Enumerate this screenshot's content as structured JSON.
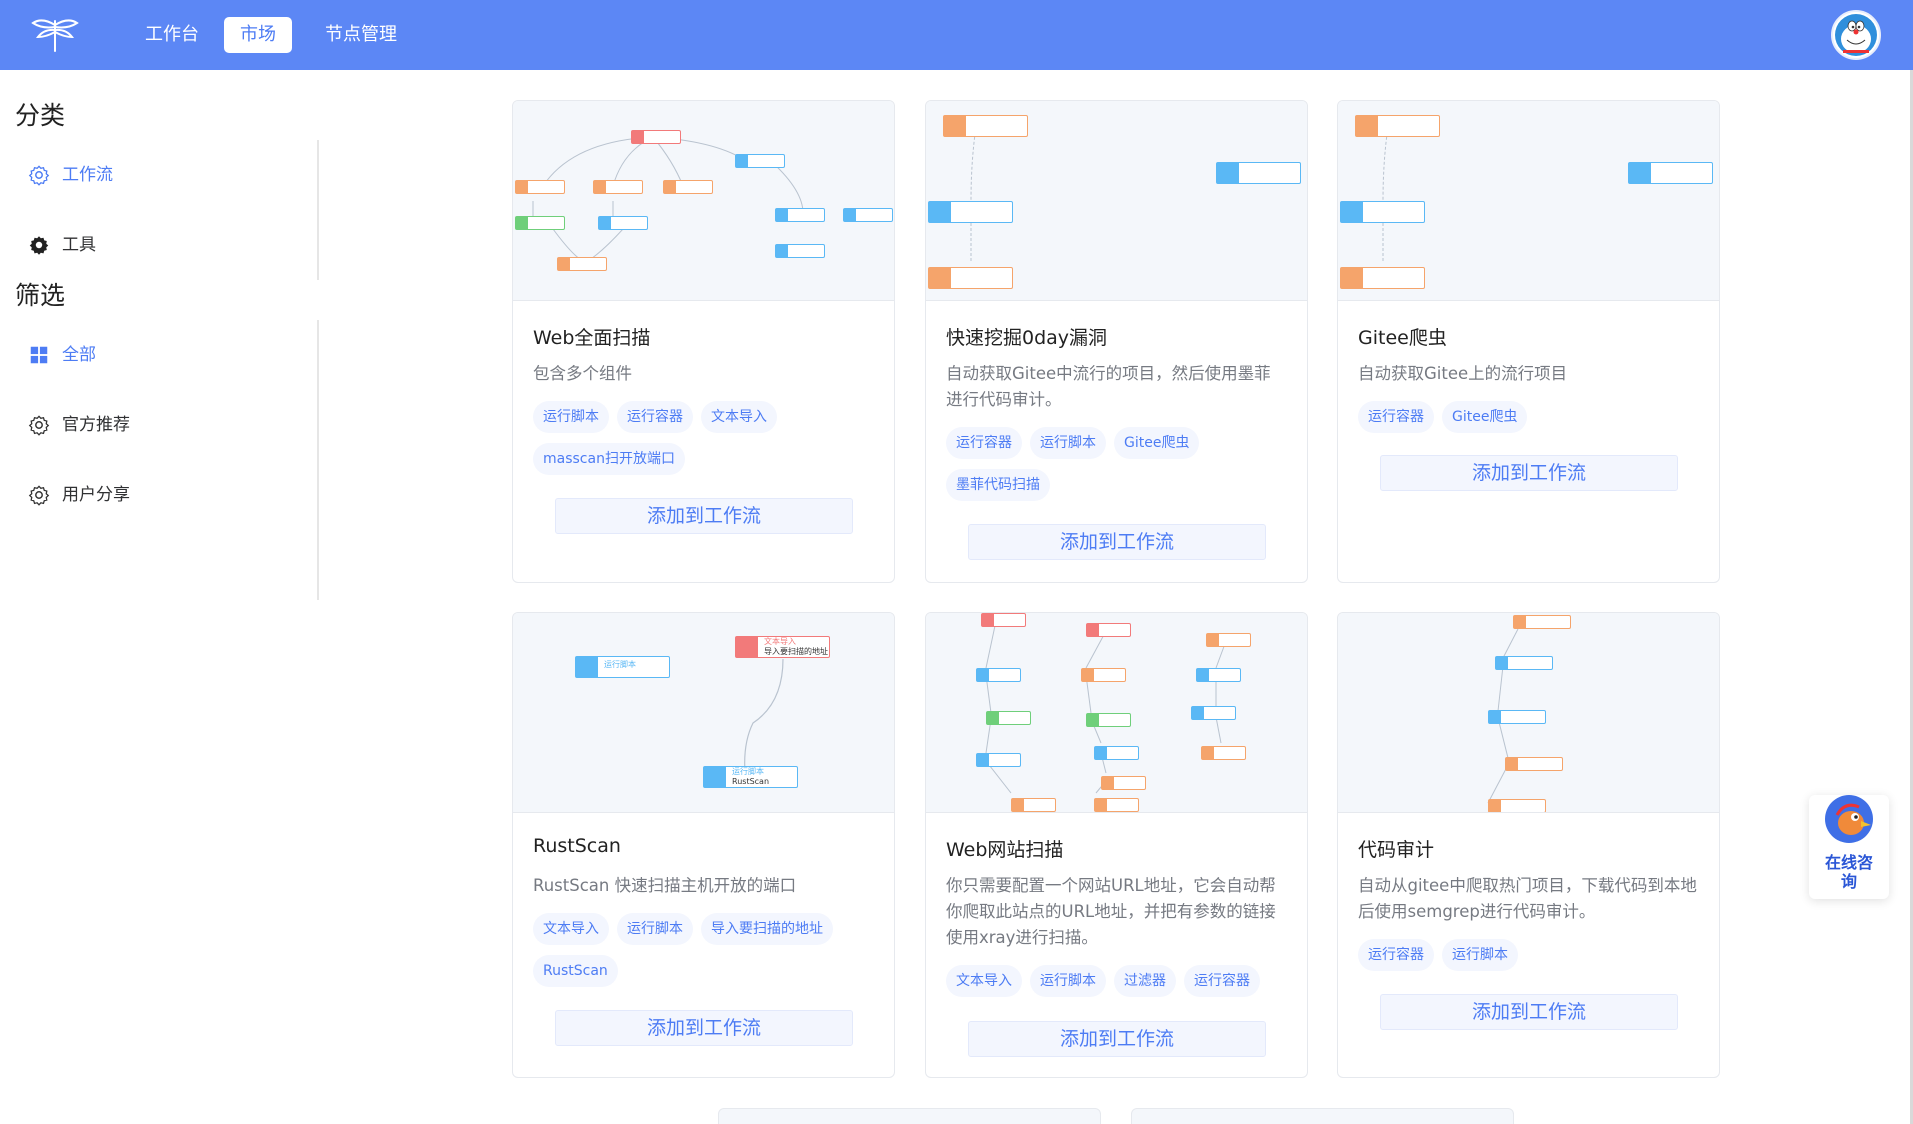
{
  "nav": {
    "items": [
      {
        "label": "工作台",
        "active": false
      },
      {
        "label": "市场",
        "active": true
      },
      {
        "label": "节点管理",
        "active": false
      }
    ]
  },
  "sidebar": {
    "category_title": "分类",
    "categories": [
      {
        "label": "工作流",
        "icon": "gear-icon",
        "active": true
      },
      {
        "label": "工具",
        "icon": "gear-filled-icon",
        "active": false
      }
    ],
    "filter_title": "筛选",
    "filters": [
      {
        "label": "全部",
        "icon": "grid-icon",
        "active": true
      },
      {
        "label": "官方推荐",
        "icon": "gear-icon",
        "active": false
      },
      {
        "label": "用户分享",
        "icon": "gear-icon",
        "active": false
      }
    ]
  },
  "cards": [
    {
      "title": "Web全面扫描",
      "desc": "包含多个组件",
      "tags": [
        "运行脚本",
        "运行容器",
        "文本导入",
        "masscan扫开放端口"
      ],
      "button": "添加到工作流"
    },
    {
      "title": "快速挖掘0day漏洞",
      "desc": "自动获取Gitee中流行的项目，然后使用墨菲进行代码审计。",
      "tags": [
        "运行容器",
        "运行脚本",
        "Gitee爬虫",
        "墨菲代码扫描"
      ],
      "button": "添加到工作流"
    },
    {
      "title": "Gitee爬虫",
      "desc": "自动获取Gitee上的流行项目",
      "tags": [
        "运行容器",
        "Gitee爬虫"
      ],
      "button": "添加到工作流"
    },
    {
      "title": "RustScan",
      "desc": "RustScan 快速扫描主机开放的端口",
      "tags": [
        "文本导入",
        "运行脚本",
        "导入要扫描的地址",
        "RustScan"
      ],
      "button": "添加到工作流"
    },
    {
      "title": "Web网站扫描",
      "desc": "你只需要配置一个网站URL地址，它会自动帮你爬取此站点的URL地址，并把有参数的链接使用xray进行扫描。",
      "tags": [
        "文本导入",
        "运行脚本",
        "过滤器",
        "运行容器"
      ],
      "button": "添加到工作流"
    },
    {
      "title": "代码审计",
      "desc": "自动从gitee中爬取热门项目，下载代码到本地后使用semgrep进行代码审计。",
      "tags": [
        "运行容器",
        "运行脚本"
      ],
      "button": "添加到工作流"
    }
  ],
  "thumb_labels": {
    "run_container": "运行容器",
    "run_script": "运行脚本",
    "text_import": "文本导入",
    "import_addr": "导入要扫描的地址",
    "rustscan": "RustScan"
  },
  "consult": {
    "label": "在线咨询"
  },
  "colors": {
    "primary": "#5c87f5",
    "accent": "#4d7cf4",
    "orange": "#f5a46b",
    "blue": "#5ab8f5",
    "red": "#f27a7a",
    "green": "#6fcf7a"
  }
}
